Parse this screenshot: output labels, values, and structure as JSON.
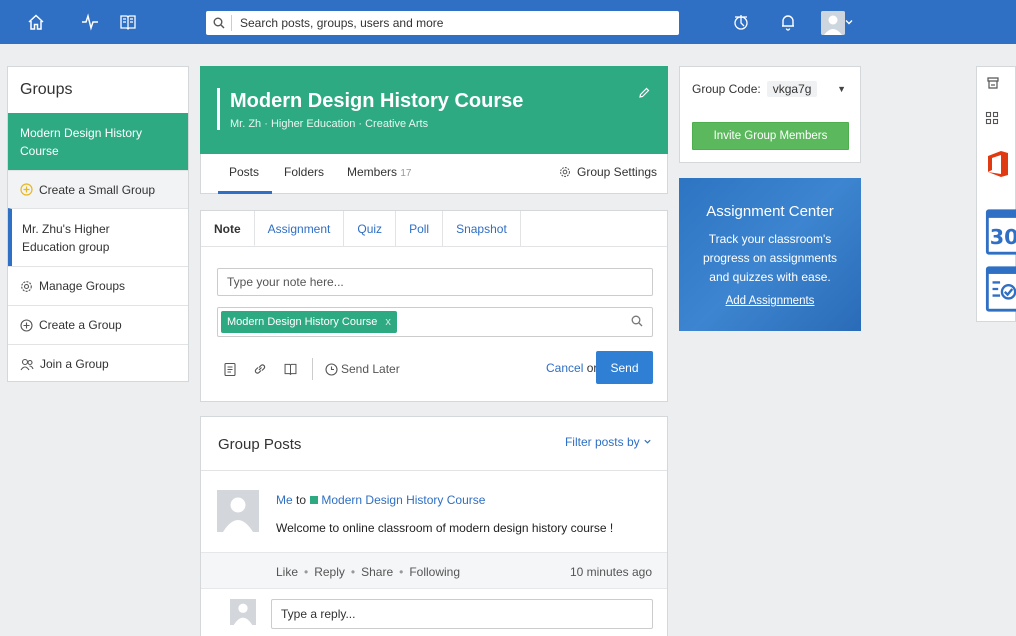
{
  "topbar": {
    "icons": [
      "home-icon",
      "activity-icon",
      "book-icon"
    ],
    "search_placeholder": "Search posts, groups, users and more",
    "right_icons": [
      "backpack-icon",
      "bell-icon",
      "user-avatar",
      "chevron-down-icon"
    ]
  },
  "groups": {
    "title": "Groups",
    "active_item": "Modern Design History Course",
    "create_small": "Create a Small Group",
    "other_group": "Mr. Zhu's Higher Education group",
    "manage": "Manage Groups",
    "create": "Create a Group",
    "join": "Join a Group"
  },
  "header": {
    "title": "Modern Design History Course",
    "subtitle": "Mr. Zh · Higher Education · Creative Arts"
  },
  "tabs": {
    "posts": "Posts",
    "folders": "Folders",
    "members": "Members",
    "members_count": "17",
    "settings": "Group Settings"
  },
  "composer": {
    "tabs": [
      "Note",
      "Assignment",
      "Quiz",
      "Poll",
      "Snapshot"
    ],
    "note_placeholder": "Type your note here...",
    "chip": "Modern Design History Course",
    "chip_x": "x",
    "send_later": "Send Later",
    "cancel": "Cancel",
    "or": "or",
    "send": "Send"
  },
  "posts": {
    "title": "Group Posts",
    "filter": "Filter posts by",
    "from": "Me",
    "to": "to",
    "group": "Modern Design History Course",
    "message": "Welcome to online classroom of modern design history course !",
    "actions": [
      "Like",
      "Reply",
      "Share",
      "Following"
    ],
    "time": "10 minutes ago",
    "reply_placeholder": "Type a reply..."
  },
  "code": {
    "label": "Group Code:",
    "value": "vkga7g",
    "invite": "Invite Group Members"
  },
  "assignment_center": {
    "title": "Assignment Center",
    "text": "Track your classroom's progress on assignments and quizzes with ease.",
    "link": "Add Assignments"
  },
  "rightbar": {
    "icons": [
      "store-icon",
      "apps-grid-icon",
      "office-icon",
      "calendar-icon",
      "checklist-icon"
    ],
    "calendar_num": "30"
  },
  "colors": {
    "topbar": "#2f6fc4",
    "green": "#2eaa82",
    "link_blue": "#2f6fc4",
    "invite_green": "#5cb85c",
    "office_red": "#e03a12"
  }
}
